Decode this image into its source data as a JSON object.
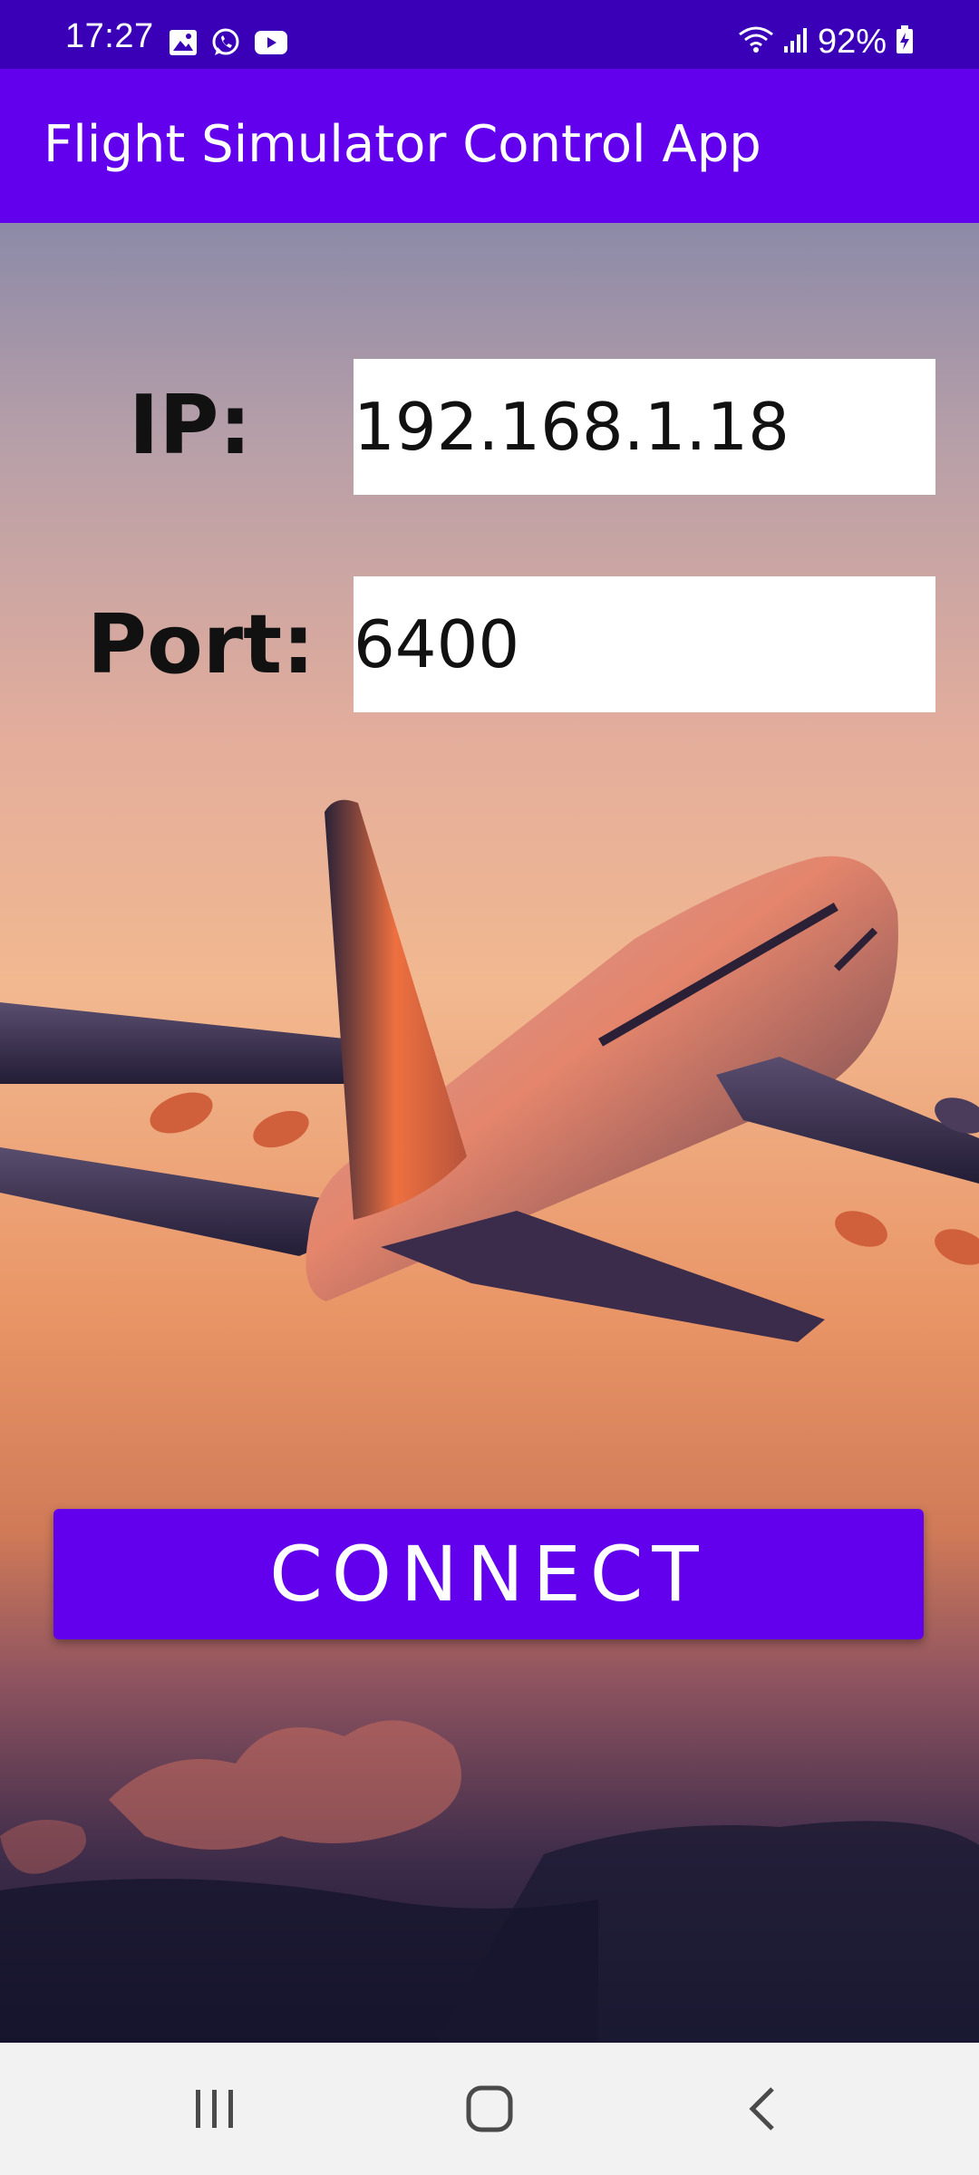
{
  "status_bar": {
    "time": "17:27",
    "battery_text": "92%",
    "left_icons": [
      "gallery-icon",
      "whatsapp-icon",
      "youtube-icon"
    ],
    "right_icons": [
      "wifi-icon",
      "signal-icon",
      "battery-charging-icon"
    ]
  },
  "app_bar": {
    "title": "Flight Simulator Control App",
    "color": "#6200ee"
  },
  "form": {
    "ip_label": "IP:",
    "ip_value": "192.168.1.18",
    "port_label": "Port:",
    "port_value": "6400"
  },
  "connect_button": {
    "label": "CONNECT"
  },
  "nav_bar": {
    "icons": [
      "recent-apps-icon",
      "home-icon",
      "back-icon"
    ]
  }
}
